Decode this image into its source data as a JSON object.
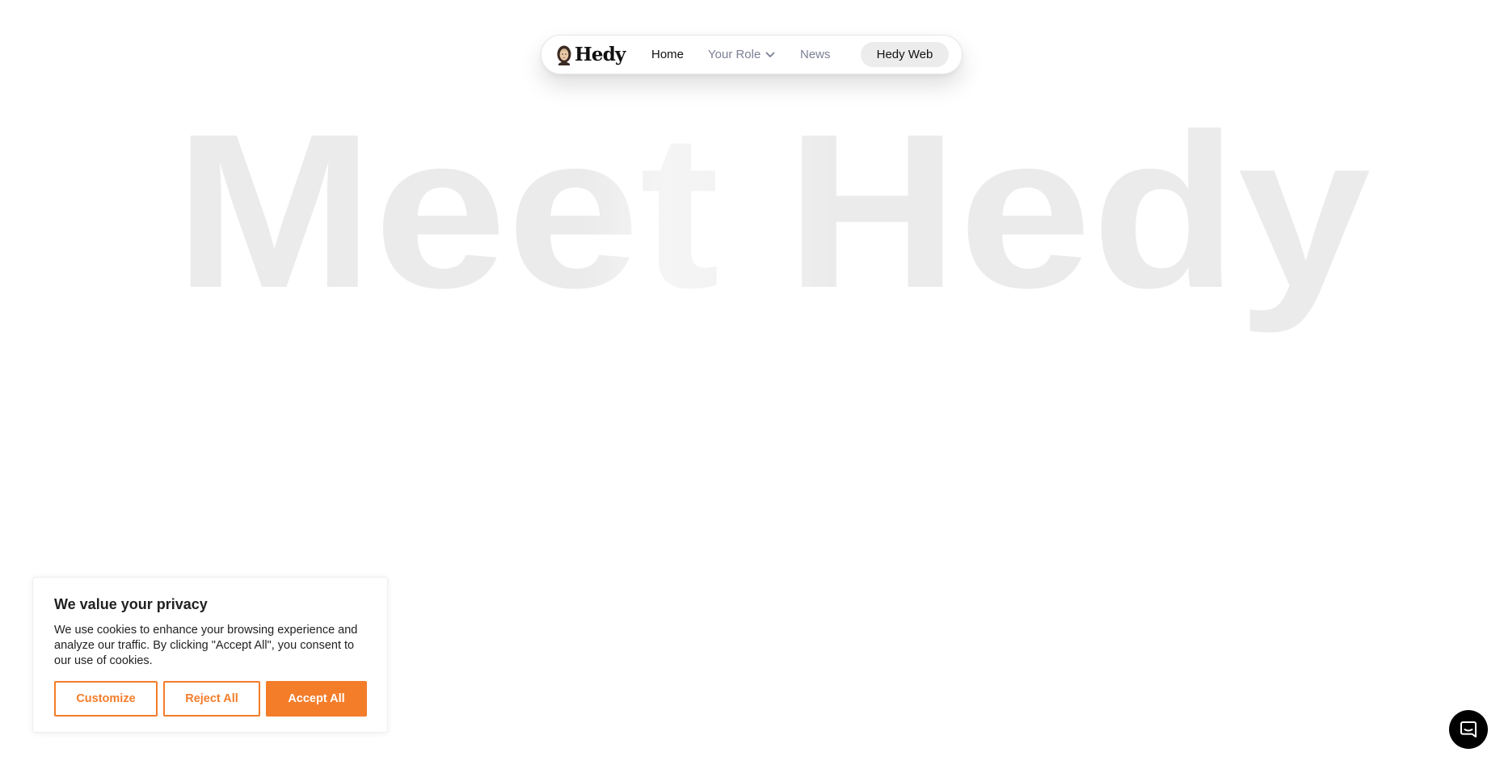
{
  "nav": {
    "logo_text": "Hedy",
    "links": [
      {
        "label": "Home",
        "active": true
      },
      {
        "label": "Your Role",
        "has_dropdown": true
      },
      {
        "label": "News"
      }
    ],
    "cta_label": "Hedy Web"
  },
  "hero": {
    "heading": "Meet Hedy",
    "color": "#ebebeb"
  },
  "cookie_banner": {
    "title": "We value your privacy",
    "body": "We use cookies to enhance your browsing experience and analyze our traffic. By clicking \"Accept All\", you consent to our use of cookies.",
    "buttons": {
      "customize": "Customize",
      "reject": "Reject All",
      "accept": "Accept All"
    },
    "accent_color": "#f47d2a"
  },
  "chat_launcher": {
    "icon": "chat-icon"
  }
}
